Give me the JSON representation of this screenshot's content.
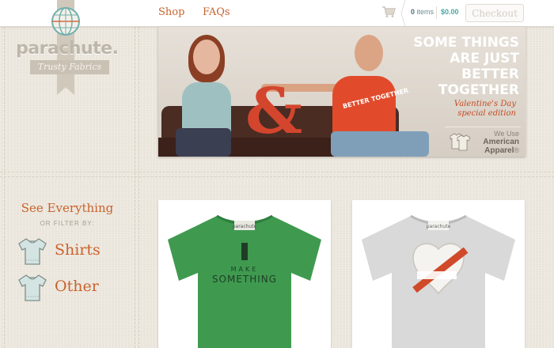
{
  "brand": {
    "name": "parachute.",
    "tagline": "Trusty Fabrics"
  },
  "nav": {
    "items": [
      {
        "label": "Shop"
      },
      {
        "label": "FAQs"
      }
    ]
  },
  "cart": {
    "count": "0",
    "count_suffix": "items",
    "total": "$0.00",
    "checkout_label": "Checkout"
  },
  "hero": {
    "headline_lines": [
      "SOME THINGS",
      "ARE JUST",
      "BETTER",
      "TOGETHER"
    ],
    "subheadline_lines": [
      "Valentine's Day",
      "special edition"
    ],
    "shirt_text": "BETTER TOGETHER",
    "ampersand": "&",
    "badge_lines": [
      "We Use",
      "American",
      "Apparel"
    ],
    "badge_mark": "®"
  },
  "filters": {
    "heading": "See Everything",
    "subheading": "OR FILTER BY:",
    "items": [
      {
        "label": "Shirts"
      },
      {
        "label": "Other"
      }
    ]
  },
  "products": [
    {
      "tag": "parachute",
      "print_lines": [
        "MAKE",
        "SOMETHING"
      ]
    },
    {
      "tag": "parachute"
    }
  ],
  "colors": {
    "accent": "#c9622c",
    "teal": "#4aa7a3",
    "background": "#ece7dd",
    "shirt_green": "#3f9a4f",
    "shirt_grey": "#d9d9d9",
    "shirt_red": "#e14b2c"
  }
}
